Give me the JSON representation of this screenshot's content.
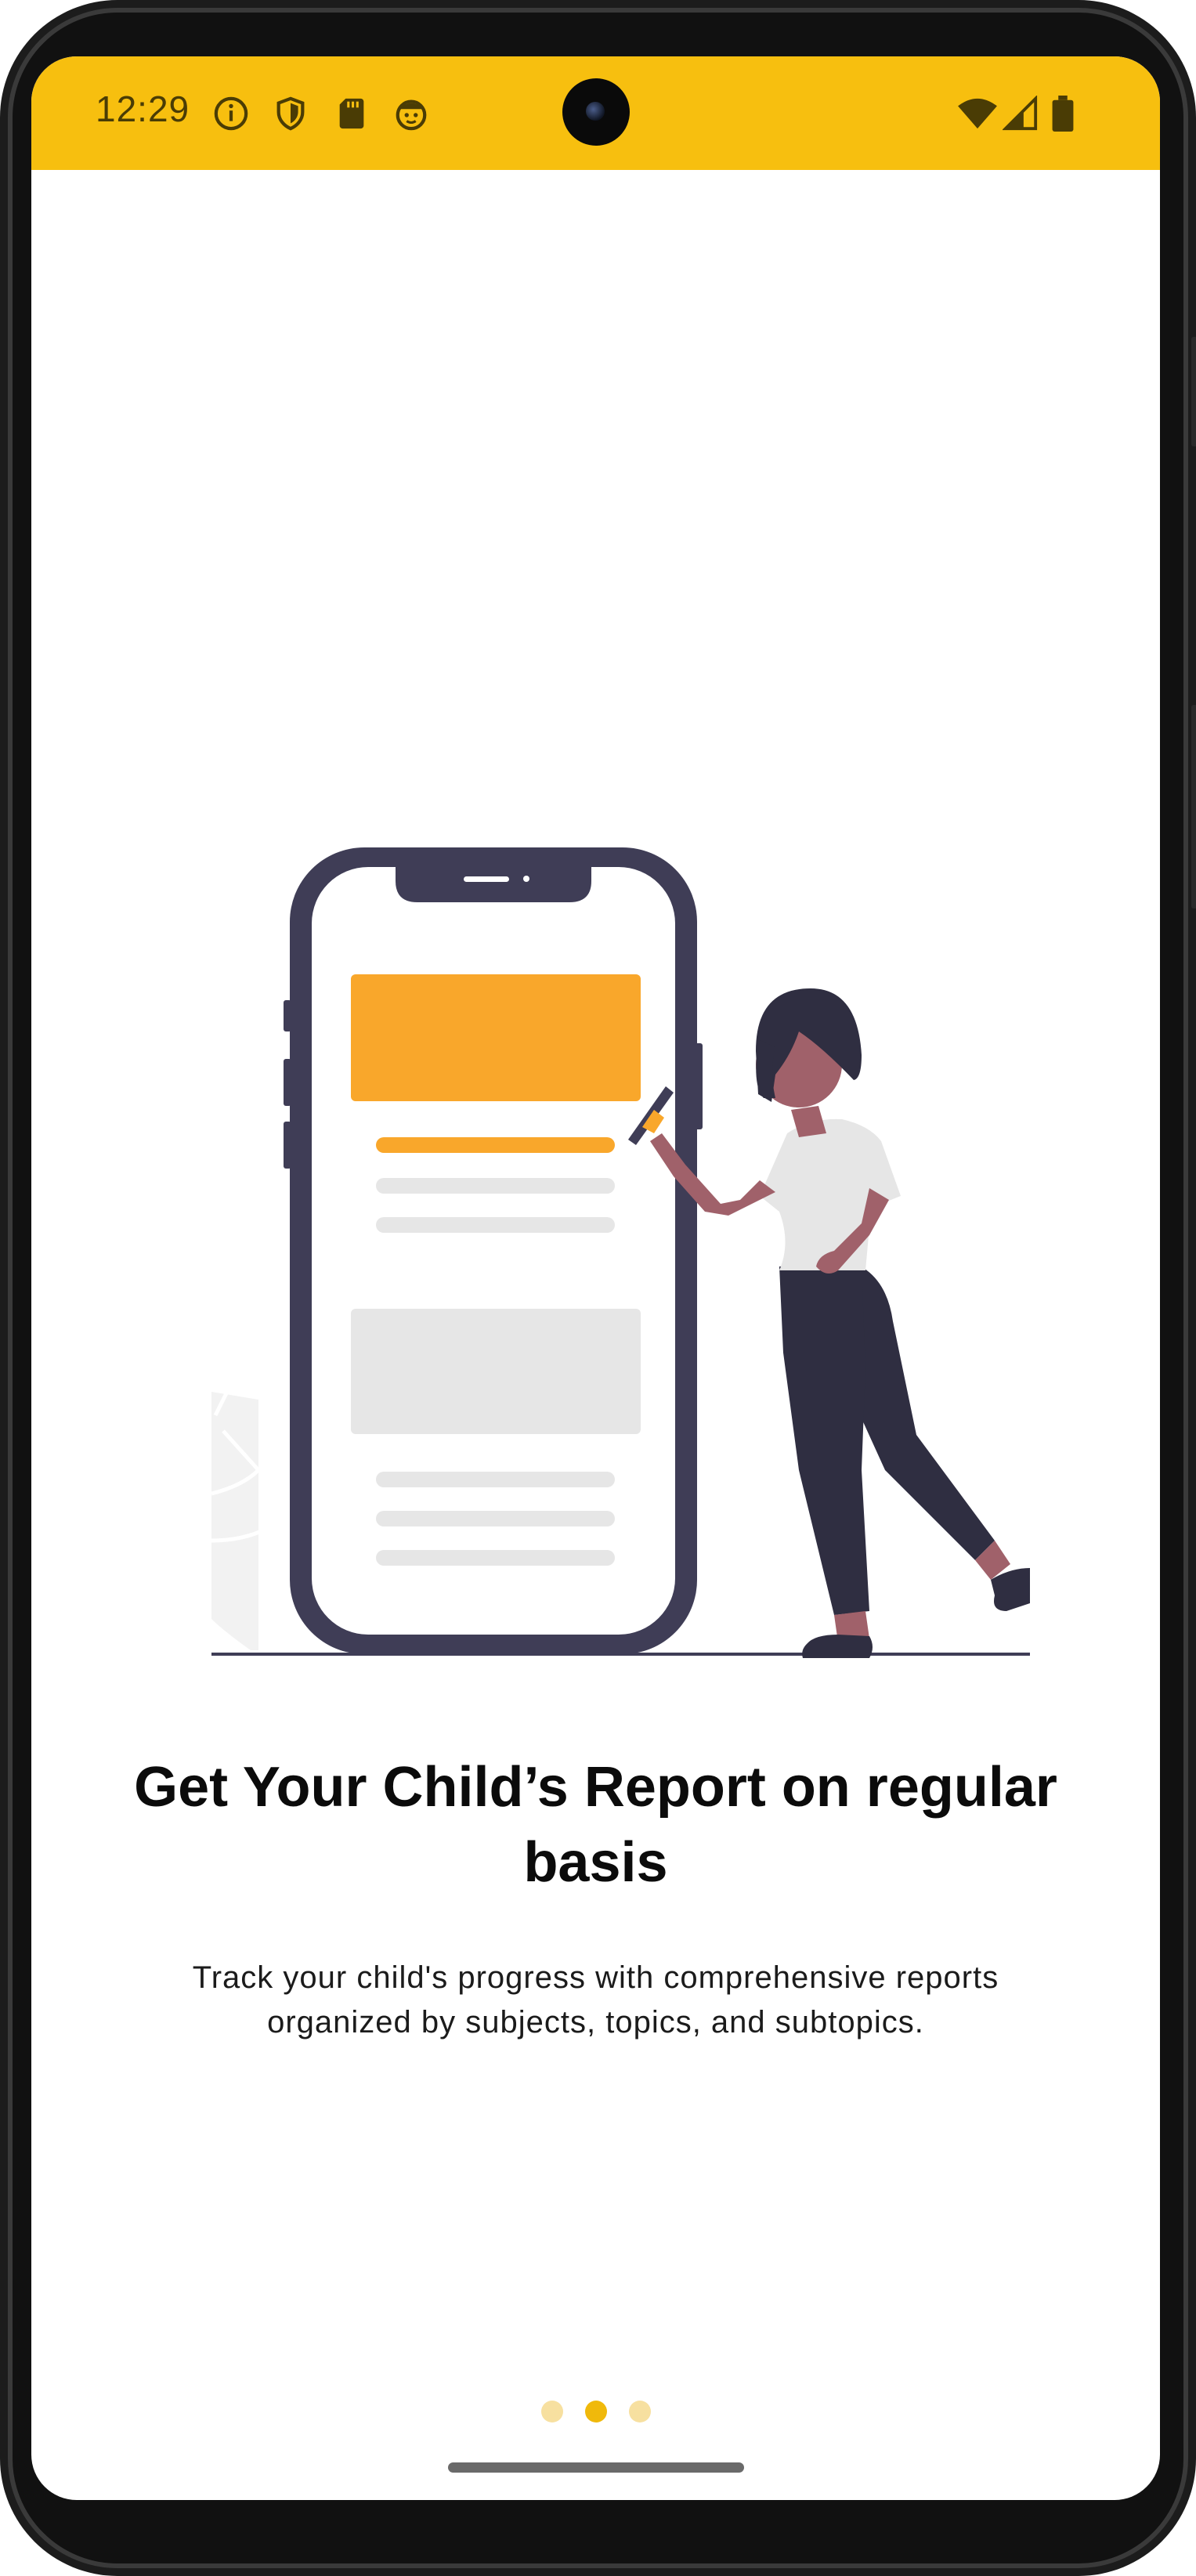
{
  "status_bar": {
    "time": "12:29",
    "icons": [
      "info-icon",
      "shield-icon",
      "sd-card-icon",
      "face-icon"
    ],
    "right_icons": [
      "wifi-icon",
      "signal-icon",
      "battery-icon"
    ],
    "color": "#f7bf0f"
  },
  "onboarding": {
    "title": "Get Your Child’s Report on regular basis",
    "description": "Track your child's progress with comprehensive reports organized by subjects, topics, and subtopics.",
    "pager": {
      "count": 3,
      "active_index": 1,
      "active_color": "#f0b90b",
      "inactive_color": "#f7e0a0"
    }
  }
}
